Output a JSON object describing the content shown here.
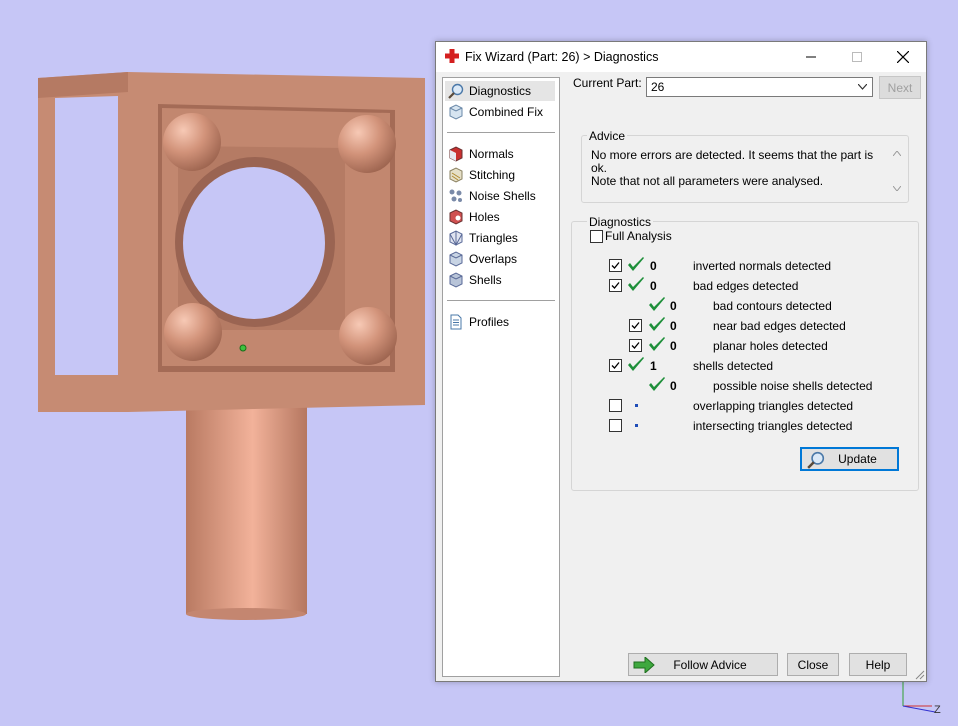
{
  "window": {
    "title": "Fix Wizard (Part: 26) > Diagnostics"
  },
  "nav": {
    "top_items": [
      {
        "label": "Diagnostics"
      },
      {
        "label": "Combined Fix"
      }
    ],
    "fix_items": [
      {
        "label": "Normals"
      },
      {
        "label": "Stitching"
      },
      {
        "label": "Noise Shells"
      },
      {
        "label": "Holes"
      },
      {
        "label": "Triangles"
      },
      {
        "label": "Overlaps"
      },
      {
        "label": "Shells"
      }
    ],
    "profiles_label": "Profiles"
  },
  "current_part": {
    "label": "Current Part:",
    "value": "26",
    "next_label": "Next"
  },
  "advice": {
    "label": "Advice",
    "text": "No more errors are detected. It seems that the part is ok.\nNote that not all parameters were analysed."
  },
  "diagnostics": {
    "label": "Diagnostics",
    "full_analysis_label": "Full Analysis",
    "rows": [
      {
        "count": "0",
        "label": "inverted normals detected"
      },
      {
        "count": "0",
        "label": "bad edges detected"
      },
      {
        "count": "0",
        "label": "bad contours detected"
      },
      {
        "count": "0",
        "label": "near bad edges detected"
      },
      {
        "count": "0",
        "label": "planar holes detected"
      },
      {
        "count": "1",
        "label": "shells detected"
      },
      {
        "count": "0",
        "label": "possible noise shells detected"
      },
      {
        "count": "",
        "label": "overlapping triangles detected"
      },
      {
        "count": "",
        "label": "intersecting triangles detected"
      }
    ],
    "update_label": "Update"
  },
  "footer": {
    "follow_advice_label": "Follow Advice",
    "close_label": "Close",
    "help_label": "Help"
  },
  "axis": {
    "z_label": "Z"
  },
  "colors": {
    "background": "#c6c6f6",
    "part": "#c88a70",
    "check": "#1e8f3a",
    "accent": "#0078d7"
  }
}
